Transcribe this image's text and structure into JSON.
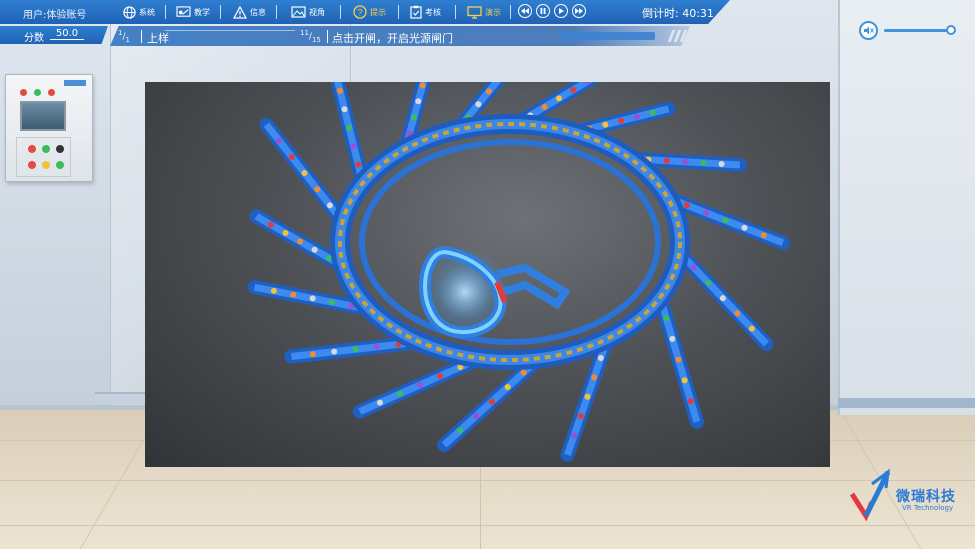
{
  "header": {
    "user_label": "用户:体验账号",
    "menu": [
      {
        "label": "系统",
        "icon": "globe-icon"
      },
      {
        "label": "教学",
        "icon": "teacher-icon"
      },
      {
        "label": "信息",
        "icon": "warning-icon"
      },
      {
        "label": "视角",
        "icon": "image-icon"
      },
      {
        "label": "提示",
        "icon": "question-icon"
      },
      {
        "label": "考核",
        "icon": "clipboard-check-icon"
      },
      {
        "label": "演示",
        "icon": "monitor-icon"
      }
    ],
    "media_controls": [
      "rewind",
      "pause",
      "play",
      "fast-forward"
    ],
    "timer_text": "倒计时: 40:31"
  },
  "score": {
    "label": "分数",
    "value": "50.0"
  },
  "steps": {
    "section_current": "1",
    "section_total": "1",
    "section_name": "上样",
    "step_current": "11",
    "step_total": "15",
    "step_instruction": "点击开闸，开启光源闸门"
  },
  "volume": {
    "level": 1.0
  },
  "logo": {
    "name_cn": "微瑞科技",
    "name_en": "VR Technology"
  },
  "colors": {
    "accent": "#1f62b5",
    "highlight": "#f4d24a",
    "beamline_blue": "#2f7fe0"
  }
}
